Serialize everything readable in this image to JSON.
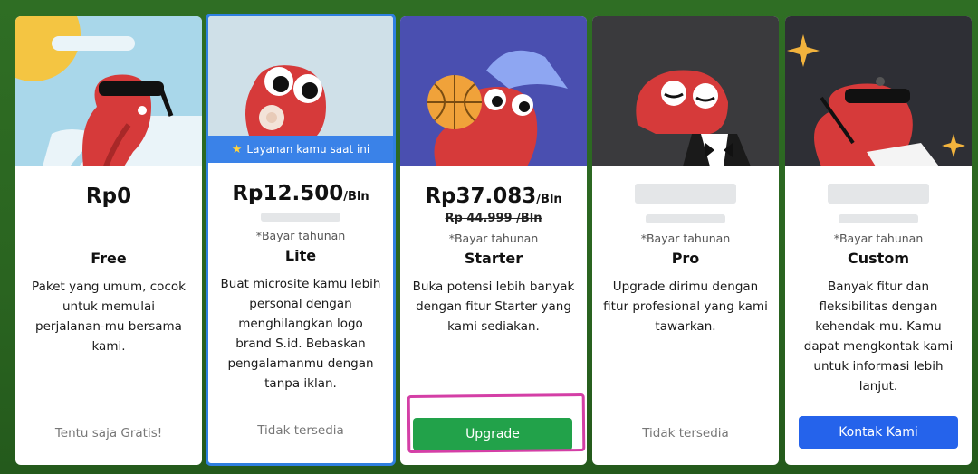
{
  "current_badge": "Layanan kamu saat ini",
  "plans": [
    {
      "price": "Rp0",
      "per": "",
      "note": "",
      "name": "Free",
      "description": "Paket yang umum, cocok untuk memulai perjalanan-mu bersama kami.",
      "footer": "Tentu saja Gratis!"
    },
    {
      "price": "Rp12.500",
      "per": "/Bln",
      "note": "*Bayar tahunan",
      "name": "Lite",
      "description": "Buat microsite kamu lebih personal dengan menghilangkan logo brand S.id. Bebaskan pengalamanmu dengan tanpa iklan.",
      "footer": "Tidak tersedia"
    },
    {
      "price": "Rp37.083",
      "per": "/Bln",
      "old_price": "Rp 44.999 /Bln",
      "note": "*Bayar tahunan",
      "name": "Starter",
      "description": "Buka potensi lebih banyak dengan fitur Starter yang kami sediakan.",
      "button": "Upgrade"
    },
    {
      "price": "",
      "note": "*Bayar tahunan",
      "name": "Pro",
      "description": "Upgrade dirimu dengan fitur profesional yang kami tawarkan.",
      "footer": "Tidak tersedia"
    },
    {
      "price": "",
      "note": "*Bayar tahunan",
      "name": "Custom",
      "description": "Banyak fitur dan fleksibilitas dengan kehendak-mu. Kamu dapat mengkontak kami untuk informasi lebih lanjut.",
      "button": "Kontak Kami"
    }
  ],
  "icons": [
    "star-icon"
  ],
  "colors": {
    "accent_blue": "#2f7fe0",
    "upgrade_green": "#22a24a",
    "contact_blue": "#2563eb",
    "highlight_pink": "#d43fa6",
    "worm_red": "#d63a3a"
  }
}
